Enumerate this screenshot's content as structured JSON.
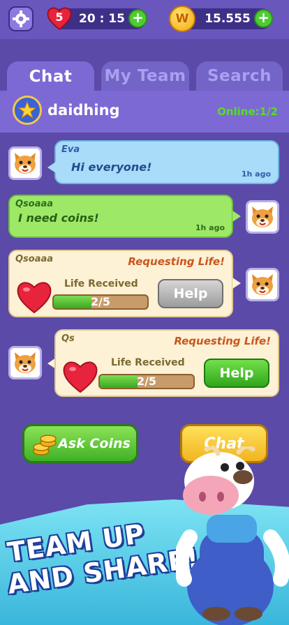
{
  "topbar": {
    "lives_count": "5",
    "timer": "20 : 15",
    "coin_symbol": "W",
    "coins": "15.555",
    "plus": "+"
  },
  "tabs": [
    {
      "label": "Chat",
      "active": true
    },
    {
      "label": "My Team",
      "active": false
    },
    {
      "label": "Search",
      "active": false
    }
  ],
  "team": {
    "name": "daidhing",
    "online": "Online:1/2"
  },
  "messages": [
    {
      "sender": "Eva",
      "text": "Hi everyone!",
      "time": "1h ago",
      "color": "#a8dcf8"
    },
    {
      "sender": "Qsoaaa",
      "text": "I need coins!",
      "time": "1h ago",
      "color": "#9ee867"
    }
  ],
  "requests": [
    {
      "sender": "Qsoaaa",
      "title": "Requesting Life!",
      "label": "Life Received",
      "progress": "2/5",
      "progress_fraction": 0.4,
      "button": "Help",
      "button_state": "disabled"
    },
    {
      "sender": "Qs",
      "title": "Requesting Life!",
      "label": "Life Received",
      "progress": "2/5",
      "progress_fraction": 0.4,
      "button": "Help",
      "button_state": "enabled"
    }
  ],
  "actions": {
    "ask_coins": "Ask Coins",
    "chat": "Chat"
  },
  "promo": {
    "line1": "TEAM UP",
    "line2": "AND SHARE!"
  },
  "colors": {
    "background": "#5b4aa8",
    "panel": "#7d69d3",
    "online": "#55dd2a",
    "request_title": "#c9561e"
  }
}
